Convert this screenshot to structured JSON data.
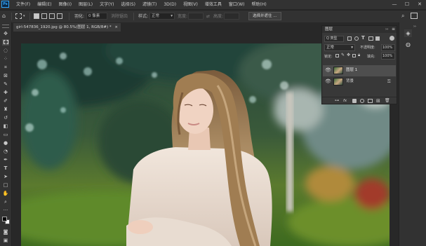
{
  "app": {
    "logo": "Ps"
  },
  "menu": [
    "文件(F)",
    "编辑(E)",
    "图像(I)",
    "图层(L)",
    "文字(Y)",
    "选择(S)",
    "滤镜(T)",
    "3D(D)",
    "视图(V)",
    "增效工具",
    "窗口(W)",
    "帮助(H)"
  ],
  "window_controls": {
    "minimize": "—",
    "maximize": "☐",
    "close": "✕"
  },
  "options": {
    "feather_label": "羽化:",
    "feather_value": "0 像素",
    "antialias_label": "消除锯齿",
    "style_label": "样式:",
    "style_value": "正常",
    "width_label": "宽度:",
    "height_label": "高度:",
    "select_mask_button": "选择并遮住 ..."
  },
  "document": {
    "tab_title": "girl-547836_1920.jpg @ 80.5%(图层 1, RGB/8#) *",
    "close": "×"
  },
  "layers_panel": {
    "title": "图层",
    "collapse": "››",
    "menu": "≡",
    "filter_label": "Q 类型",
    "blend_mode": "正常",
    "opacity_label": "不透明度:",
    "opacity_value": "100%",
    "lock_label": "锁定:",
    "fill_label": "填充:",
    "fill_value": "100%",
    "layers": [
      {
        "name": "图层 1",
        "visible": true,
        "selected": true
      },
      {
        "name": "背景",
        "visible": true,
        "selected": false,
        "locked": true
      }
    ]
  },
  "colors": {
    "accent": "#31a8ff",
    "panel": "#383838",
    "selected_layer": "#4e4e4e"
  }
}
